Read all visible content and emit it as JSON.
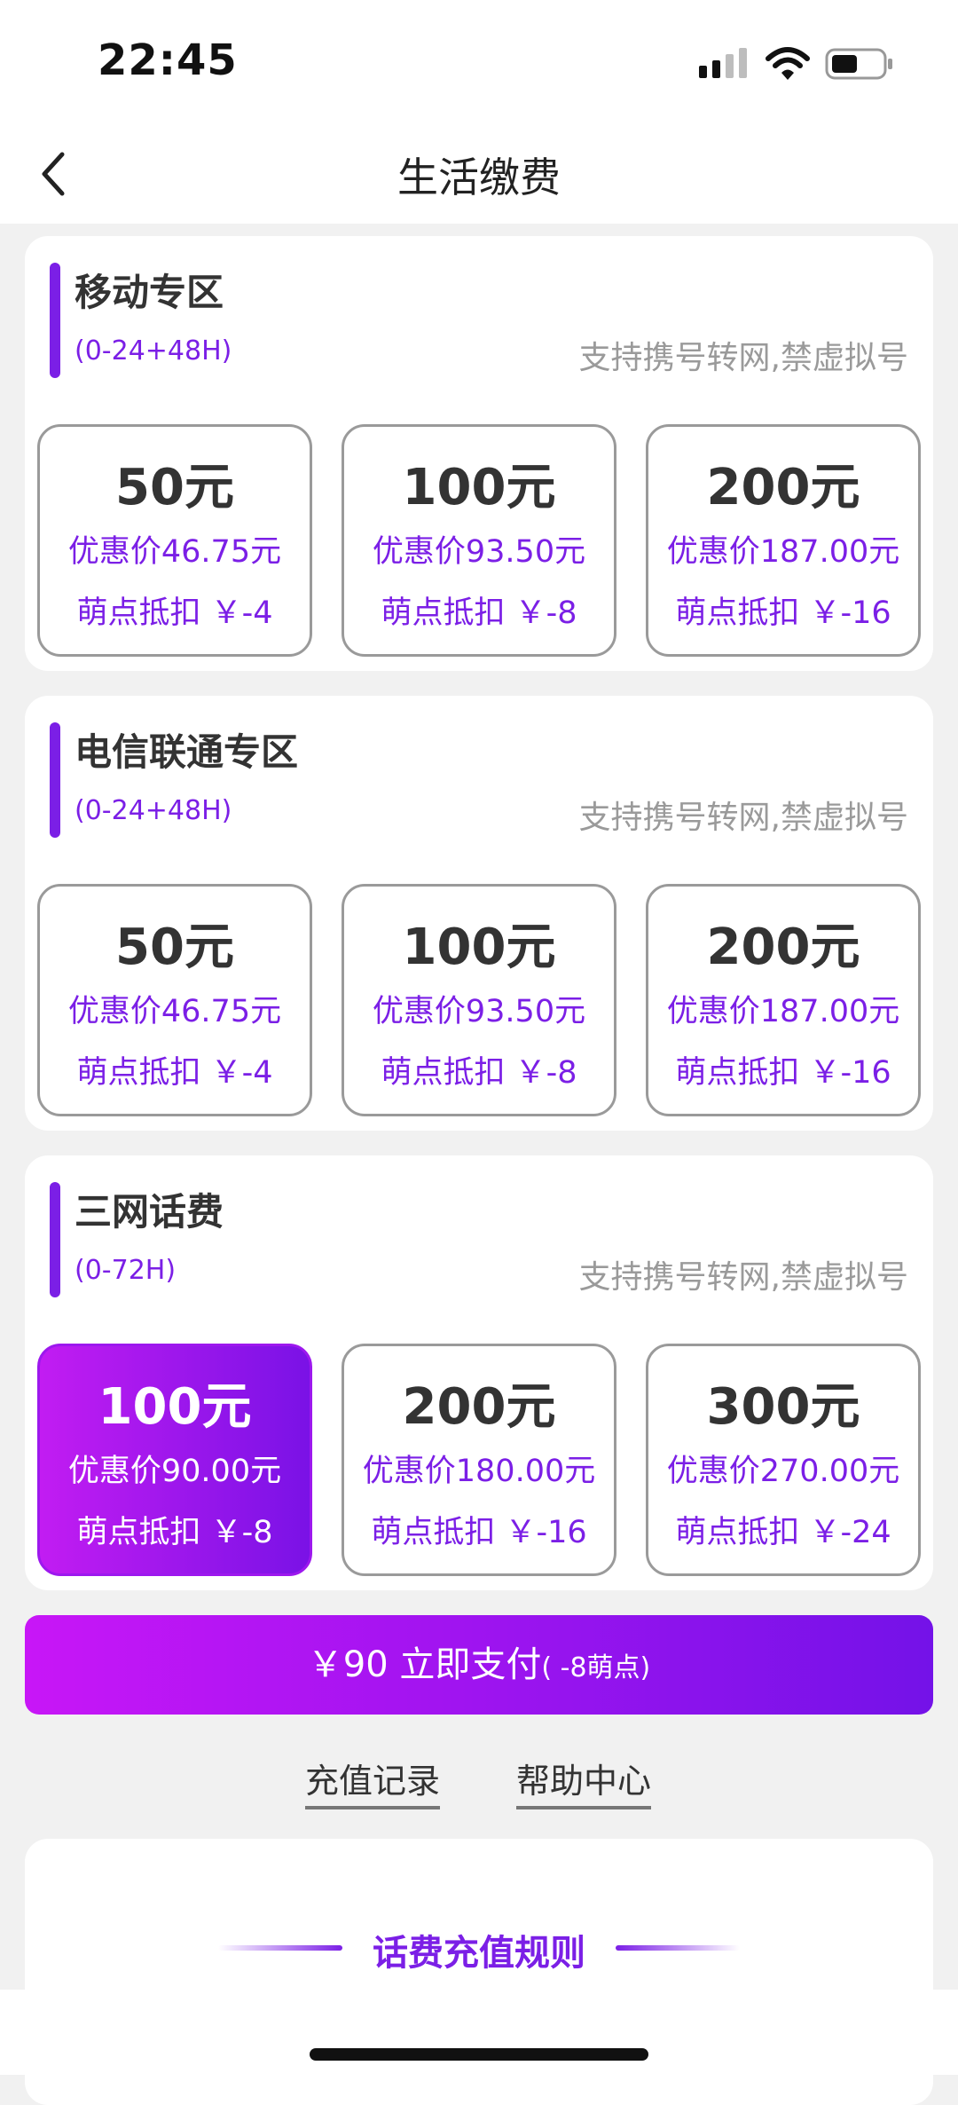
{
  "status_bar": {
    "time": "22:45",
    "icons": [
      "cellular-signal-icon",
      "wifi-icon",
      "battery-icon"
    ]
  },
  "header": {
    "title": "生活缴费",
    "back_icon": "chevron-left-icon"
  },
  "colors": {
    "accent": "#7b1fe6",
    "accent_gradient_start": "#c816f7",
    "accent_gradient_end": "#7412e8",
    "note_gray": "#9a9a9a",
    "background": "#f1f1f1"
  },
  "sections": [
    {
      "title": "移动专区",
      "time_range": "(0-24+48H)",
      "note": "支持携号转网,禁虚拟号",
      "options": [
        {
          "amount": "50元",
          "price": "优惠价46.75元",
          "points": "萌点抵扣 ￥-4",
          "selected": false
        },
        {
          "amount": "100元",
          "price": "优惠价93.50元",
          "points": "萌点抵扣 ￥-8",
          "selected": false
        },
        {
          "amount": "200元",
          "price": "优惠价187.00元",
          "points": "萌点抵扣 ￥-16",
          "selected": false
        }
      ]
    },
    {
      "title": "电信联通专区",
      "time_range": "(0-24+48H)",
      "note": "支持携号转网,禁虚拟号",
      "options": [
        {
          "amount": "50元",
          "price": "优惠价46.75元",
          "points": "萌点抵扣 ￥-4",
          "selected": false
        },
        {
          "amount": "100元",
          "price": "优惠价93.50元",
          "points": "萌点抵扣 ￥-8",
          "selected": false
        },
        {
          "amount": "200元",
          "price": "优惠价187.00元",
          "points": "萌点抵扣 ￥-16",
          "selected": false
        }
      ]
    },
    {
      "title": "三网话费",
      "time_range": "(0-72H)",
      "note": "支持携号转网,禁虚拟号",
      "options": [
        {
          "amount": "100元",
          "price": "优惠价90.00元",
          "points": "萌点抵扣 ￥-8",
          "selected": true
        },
        {
          "amount": "200元",
          "price": "优惠价180.00元",
          "points": "萌点抵扣 ￥-16",
          "selected": false
        },
        {
          "amount": "300元",
          "price": "优惠价270.00元",
          "points": "萌点抵扣 ￥-24",
          "selected": false
        }
      ]
    }
  ],
  "pay_button": {
    "label": "￥90  立即支付",
    "points_note": "( -8萌点)"
  },
  "links": {
    "records": "充值记录",
    "help": "帮助中心"
  },
  "rules": {
    "title": "话费充值规则"
  }
}
